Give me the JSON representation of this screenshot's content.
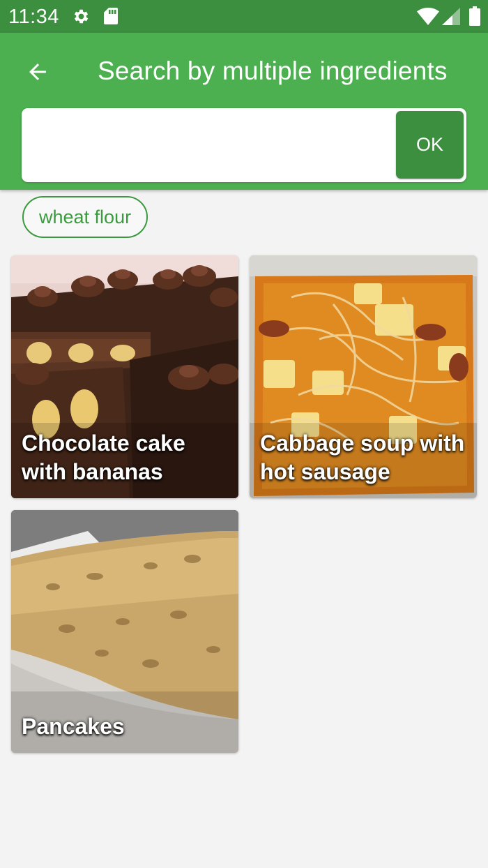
{
  "status_bar": {
    "time": "11:34",
    "icons": [
      "gear-icon",
      "sd-card-icon",
      "wifi-icon",
      "signal-icon",
      "battery-icon"
    ]
  },
  "app_bar": {
    "title": "Search by multiple ingredients",
    "back_icon": "arrow-back-icon",
    "color": "#4caf50",
    "dark_color": "#3b8f3f"
  },
  "search": {
    "value": "",
    "placeholder": "",
    "ok_label": "OK"
  },
  "chips": [
    {
      "label": "wheat flour"
    }
  ],
  "recipes": [
    {
      "title": "Chocolate cake with bananas"
    },
    {
      "title": "Cabbage soup with hot sausage"
    },
    {
      "title": "Pancakes"
    }
  ]
}
